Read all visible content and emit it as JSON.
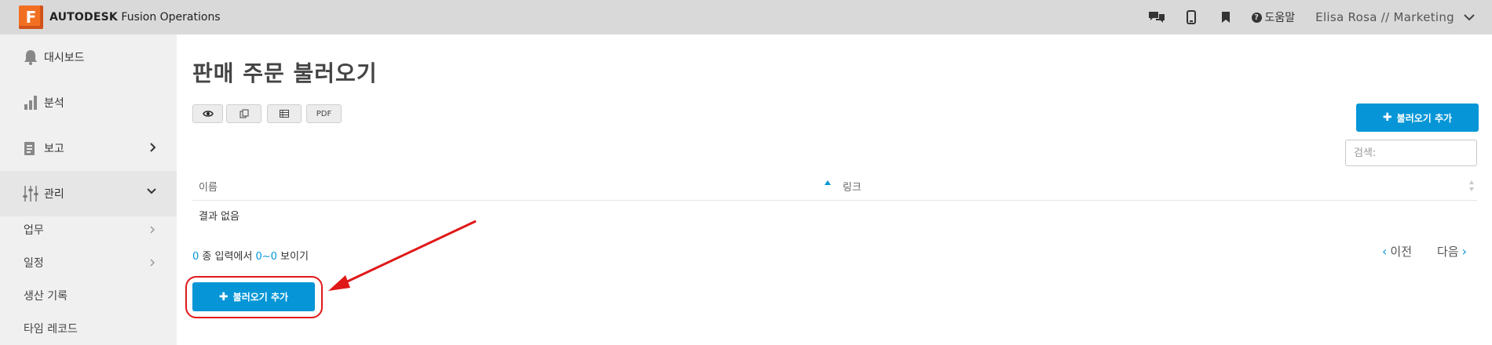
{
  "header": {
    "brand_bold": "AUTODESK",
    "brand_product": "Fusion Operations",
    "logo_letter": "F",
    "help_label": "도움말",
    "user_label": "Elisa Rosa // Marketing",
    "icons": [
      "chat-icon",
      "mobile-icon",
      "bookmark-icon",
      "help-icon",
      "chevron-down-icon"
    ]
  },
  "sidebar": {
    "items": [
      {
        "label": "대시보드",
        "icon": "bell-icon"
      },
      {
        "label": "분석",
        "icon": "bar-chart-icon"
      },
      {
        "label": "보고",
        "icon": "report-icon"
      },
      {
        "label": "관리",
        "icon": "sliders-icon"
      }
    ],
    "sub_items": [
      {
        "label": "업무"
      },
      {
        "label": "일정"
      },
      {
        "label": "생산 기록"
      },
      {
        "label": "타임 레코드"
      }
    ]
  },
  "main": {
    "title": "판매 주문 불러오기",
    "toolbar": {
      "pdf_label": "PDF"
    },
    "add_button_label": "불러오기 추가",
    "search_placeholder": "검색:",
    "table": {
      "columns": [
        "이름",
        "링크"
      ],
      "empty_text": "결과 없음"
    },
    "entries": {
      "count": "0",
      "mid": " 종 입력에서 ",
      "range": "0~0",
      "suffix": " 보이기"
    },
    "pagination": {
      "prev": "이전",
      "next": "다음"
    }
  },
  "colors": {
    "accent": "#0696d7",
    "brand": "#f26f22",
    "annotation": "#e01818"
  }
}
